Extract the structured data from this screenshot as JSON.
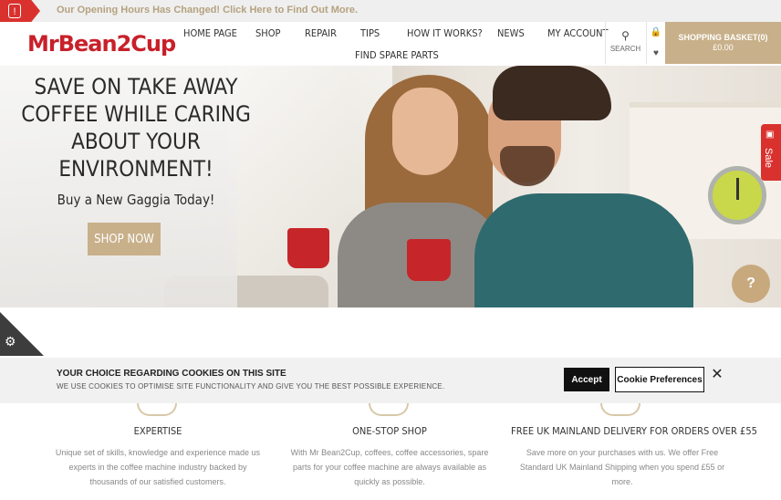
{
  "announcement": {
    "text": "Our Opening Hours Has Changed! Click Here to Find Out More.",
    "icon": "bell-icon"
  },
  "header": {
    "logo": "MrBean2Cup",
    "nav": [
      "HOME PAGE",
      "SHOP",
      "REPAIR",
      "TIPS",
      "HOW IT WORKS?",
      "NEWS",
      "MY ACCOUNT",
      "FIND SPARE PARTS"
    ],
    "search_label": "SEARCH",
    "basket_label": "SHOPPING BASKET(0)",
    "basket_total": "£0.00"
  },
  "hero": {
    "title": "SAVE ON TAKE AWAY COFFEE WHILE CARING ABOUT YOUR ENVIRONMENT!",
    "subtitle": "Buy a New Gaggia Today!",
    "cta": "SHOP NOW"
  },
  "sale_tab": {
    "label": "Sale"
  },
  "help_button": {
    "label": "?"
  },
  "cookie": {
    "title": "YOUR CHOICE REGARDING COOKIES ON THIS SITE",
    "description": "WE USE COOKIES TO OPTIMISE SITE FUNCTIONALITY AND GIVE YOU THE BEST POSSIBLE EXPERIENCE.",
    "accept": "Accept",
    "preferences": "Cookie Preferences",
    "close": "✕"
  },
  "features": [
    {
      "title": "EXPERTISE",
      "body": "Unique set of skills, knowledge and experience made us experts in the coffee machine industry backed by thousands of our satisfied customers."
    },
    {
      "title": "ONE-STOP SHOP",
      "body": "With Mr Bean2Cup, coffees, coffee accessories, spare parts for your coffee machine are always available as quickly as possible."
    },
    {
      "title": "FREE UK MAINLAND DELIVERY FOR ORDERS OVER £55",
      "body": "Save more on your purchases with us. We offer Free Standard UK Mainland Shipping when you spend £55 or more."
    }
  ],
  "colors": {
    "brand_red": "#c8202a",
    "accent_gold": "#c8b08a"
  }
}
